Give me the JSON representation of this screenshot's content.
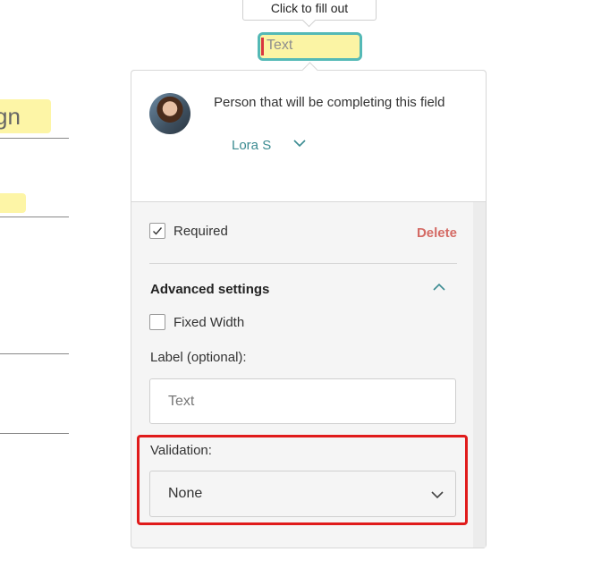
{
  "document": {
    "field_fragment_text": "gn"
  },
  "tooltip": {
    "text": "Click to fill out"
  },
  "text_field": {
    "placeholder": "Text"
  },
  "popover": {
    "assignee_label": "Person that will be completing this field",
    "assignee_name": "Lora S",
    "required_label": "Required",
    "required_checked": true,
    "delete_label": "Delete",
    "advanced_title": "Advanced settings",
    "fixed_width_label": "Fixed Width",
    "fixed_width_checked": false,
    "label_caption": "Label (optional):",
    "label_placeholder": "Text",
    "validation_caption": "Validation:",
    "validation_value": "None"
  },
  "colors": {
    "accent": "#3b8b91",
    "field_highlight": "#fbf4a4",
    "field_border": "#54b9b6",
    "delete": "#d46a64",
    "highlight_box": "#e01b1b"
  },
  "icons": {
    "assignee_dropdown": "chevron-down-icon",
    "advanced_toggle": "chevron-up-icon",
    "validation_dropdown": "chevron-down-icon",
    "required_check": "checkmark-icon"
  }
}
